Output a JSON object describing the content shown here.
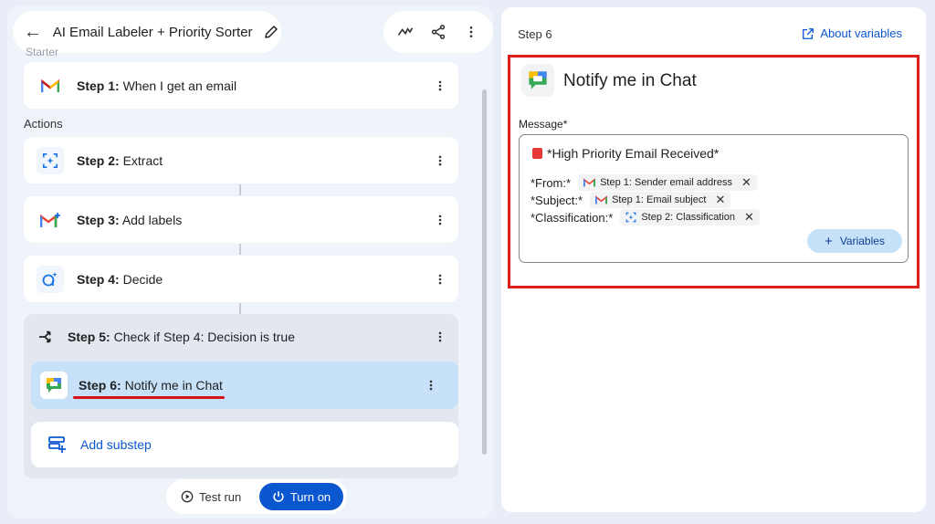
{
  "header": {
    "title": "AI Email Labeler + Priority Sorter"
  },
  "left": {
    "starter_label": "Starter",
    "actions_label": "Actions",
    "steps": [
      {
        "num": "Step 1:",
        "text": "When I get an email"
      },
      {
        "num": "Step 2:",
        "text": "Extract"
      },
      {
        "num": "Step 3:",
        "text": "Add labels"
      },
      {
        "num": "Step 4:",
        "text": "Decide"
      },
      {
        "num": "Step 5:",
        "text": "Check if Step 4: Decision is true"
      },
      {
        "num": "Step 6:",
        "text": "Notify me in Chat"
      }
    ],
    "add_substep": "Add substep",
    "test_run": "Test run",
    "turn_on": "Turn on"
  },
  "right": {
    "step_label": "Step 6",
    "about_variables": "About variables",
    "title": "Notify me in Chat",
    "message_label": "Message*",
    "line1": "*High Priority Email Received*",
    "from_label": "*From:*",
    "from_chip": "Step 1: Sender email address",
    "subject_label": "*Subject:*",
    "subject_chip": "Step 1: Email subject",
    "class_label": "*Classification:*",
    "class_chip": "Step 2: Classification",
    "variables_btn": "Variables"
  },
  "colors": {
    "accent": "#0b57d0",
    "selected": "#c7e1f8",
    "highlight": "#e01e1e"
  }
}
